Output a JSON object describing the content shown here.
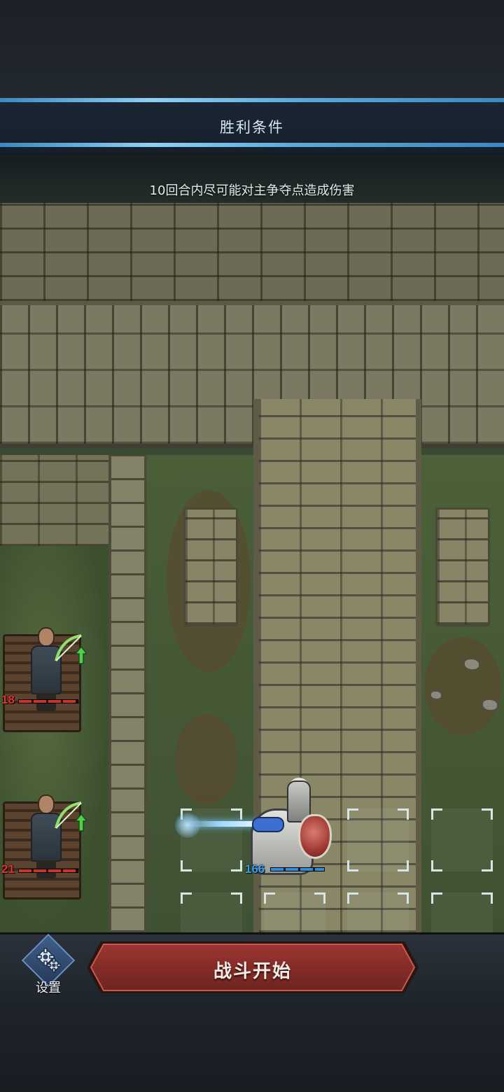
{
  "victory_conditions": {
    "title": "胜利条件",
    "description": "10回合内尽可能对主争夺点造成伤害"
  },
  "units": {
    "enemy_archer_1": {
      "level": "18",
      "role_icon": "bow-upgrade-icon",
      "health_fraction": 1.0
    },
    "enemy_archer_2": {
      "level": "21",
      "role_icon": "bow-upgrade-icon",
      "health_fraction": 1.0
    },
    "player_knight": {
      "level": "166",
      "health_fraction": 1.0
    }
  },
  "bottom_bar": {
    "settings_label": "设置",
    "start_battle_label": "战斗开始"
  },
  "colors": {
    "enemy": "#c9352b",
    "ally": "#2f8fd8",
    "banner_accent": "#5aa9da",
    "start_button": "#8e2f2a"
  }
}
